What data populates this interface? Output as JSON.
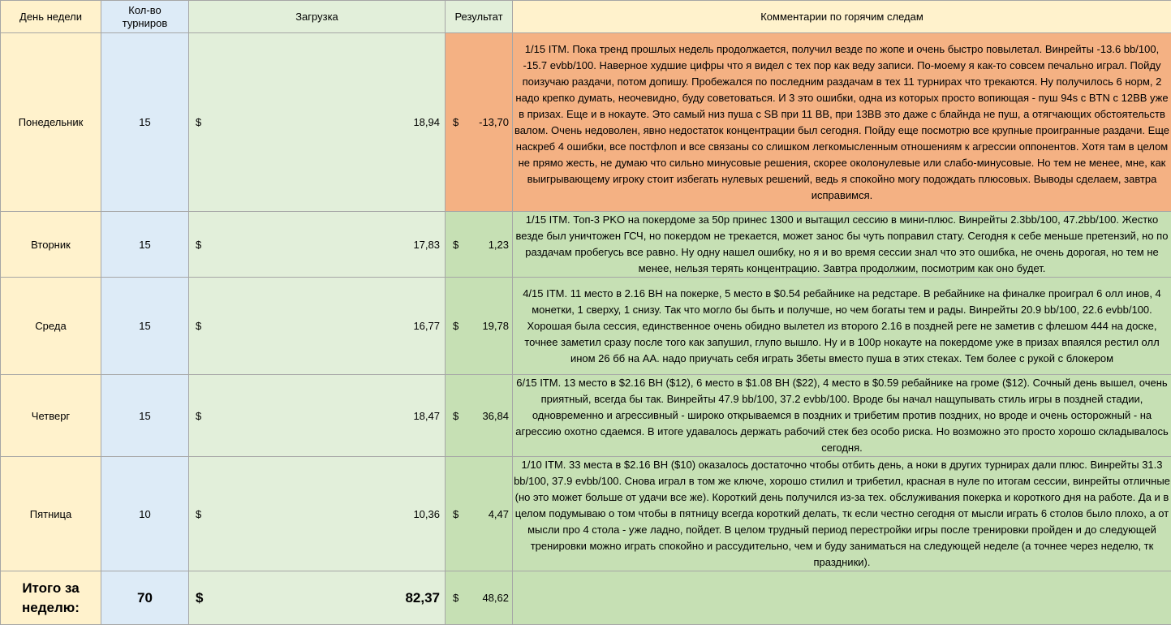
{
  "header": {
    "day": "День недели",
    "count_line1": "Кол-во",
    "count_line2": "турниров",
    "load": "Загрузка",
    "result": "Результат",
    "comments": "Комментарии по горячим следам"
  },
  "currency": "$",
  "rows": [
    {
      "day": "Понедельник",
      "count": "15",
      "load": "18,94",
      "result": "-13,70",
      "comment": "1/15 ITM. Пока тренд прошлых недель  продолжается, получил везде по жопе и очень быстро повылетал. Винрейты -13.6 bb/100, -15.7 evbb/100. Наверное худшие цифры что я видел с тех пор как веду записи. По-моему я как-то совсем печально играл. Пойду поизучаю раздачи, потом допишу. Пробежался по последним раздачам в тех 11 турнирах что трекаются. Ну получилось 6 норм, 2 надо крепко думать, неочевидно, буду советоваться. И 3 это ошибки, одна из которых просто вопиющая - пуш 94s с BTN с 12BB уже в призах. Еще и в нокауте. Это самый низ пуша с SB при 11 BB, при 13BB это даже с блайнда не пуш, а отягчающих обстоятельств валом. Очень недоволен, явно недостаток концентрации был сегодня. Пойду еще посмотрю все крупные проигранные раздачи. Еще наскреб 4 ошибки, все постфлоп и все связаны со слишком легкомысленным отношениям к агрессии оппонентов. Хотя там в целом не прямо жесть, не думаю что сильно минусовые решения, скорее околонулевые или слабо-минусовые. Но тем не менее, мне, как выигрывающему игроку стоит избегать нулевых решений, ведь я спокойно могу подождать плюсовых. Выводы сделаем, завтра исправимся."
    },
    {
      "day": "Вторник",
      "count": "15",
      "load": "17,83",
      "result": "1,23",
      "comment": "1/15 ITM. Топ-3 PKO на покердоме за 50р принес 1300 и вытащил сессию в мини-плюс. Винрейты 2.3bb/100, 47.2bb/100. Жестко везде был уничтожен ГСЧ, но покердом не трекается, может занос бы чуть поправил стату. Сегодня к себе меньше претензий, но по раздачам пробегусь все равно. Ну одну нашел ошибку, но я и во время сессии знал что это ошибка, не очень дорогая, но тем не менее, нельзя терять концентрацию. Завтра продолжим, посмотрим как оно будет."
    },
    {
      "day": "Среда",
      "count": "15",
      "load": "16,77",
      "result": "19,78",
      "comment": "4/15 ITM. 11 место в 2.16 BH на покерке, 5 место в $0.54 ребайнике на редстаре. В ребайнике на финалке проиграл 6 олл инов, 4 монетки, 1 сверху, 1 снизу. Так что могло бы быть и получше, но чем богаты тем и рады. Винрейты 20.9 bb/100, 22.6 evbb/100. Хорошая была сессия, единственное очень обидно вылетел из второго 2.16 в поздней реге не заметив с флешом 444 на доске, точнее заметил сразу после того как запушил, глупо вышло. Ну и в 100р нокауте на покердоме уже в призах впаялся рестил олл ином 26 бб на АА. надо приучать себя играть 3беты вместо пуша в этих стеках. Тем более с рукой с блокером"
    },
    {
      "day": "Четверг",
      "count": "15",
      "load": "18,47",
      "result": "36,84",
      "comment": "6/15 ITM. 13 место в $2.16 BH ($12), 6 место в $1.08 BH ($22), 4 место в $0.59 ребайнике на громе ($12). Сочный день вышел, очень приятный, всегда бы так. Винрейты 47.9 bb/100, 37.2 evbb/100. Вроде бы начал нащупывать стиль игры в поздней стадии, одновременно и агрессивный - широко открываемся в поздних и трибетим против поздних, но вроде и очень осторожный - на агрессию охотно сдаемся. В итоге удавалось держать рабочий стек без особо риска. Но возможно это просто хорошо складывалось сегодня."
    },
    {
      "day": "Пятница",
      "count": "10",
      "load": "10,36",
      "result": "4,47",
      "comment": "1/10 ITM. 33 места в $2.16 BH ($10) оказалось достаточно чтобы отбить день, а ноки в других турнирах дали плюс. Винрейты 31.3 bb/100, 37.9 evbb/100. Снова играл в том же ключе, хорошо стилил и трибетил, красная в нуле по итогам сессии, винрейты отличные (но это может больше от удачи все же). Короткий день получился из-за тех. обслуживания покерка и короткого дня на работе. Да и в целом подумываю о том чтобы в пятницу всегда короткий делать, тк если честно сегодня от мысли играть 6 столов было плохо, а от мысли про 4 стола - уже ладно, пойдет. В целом трудный период перестройки игры после тренировки пройден и до следующей тренировки можно играть спокойно и рассудительно, чем и буду заниматься на следующей неделе (а точнее через неделю, тк праздники)."
    }
  ],
  "totals": {
    "label": "Итого за неделю:",
    "count": "70",
    "load": "82,37",
    "result": "48,62"
  },
  "colors": {
    "day_bg": "#fff2cc",
    "count_bg": "#ddebf7",
    "load_bg": "#e2efda",
    "positive_bg": "#c6e0b4",
    "negative_bg": "#f4b183",
    "grid": "#a6a6a6"
  }
}
